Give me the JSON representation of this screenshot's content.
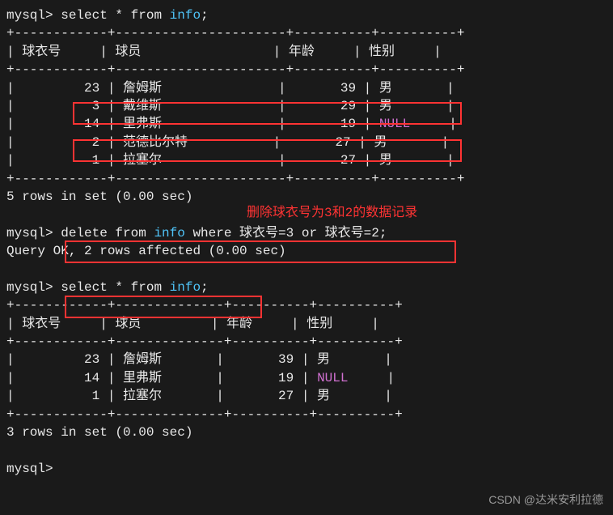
{
  "prompt": "mysql>",
  "queries": {
    "select1": "select * from ",
    "select1_table": "info",
    "select1_end": ";",
    "delete": "delete from ",
    "delete_table": "info",
    "delete_where": " where 球衣号=3 or 球衣号=2;",
    "select2": "select * from ",
    "select2_table": "info",
    "select2_end": ";"
  },
  "responses": {
    "rows1": "5 rows in set (0.00 sec)",
    "delete_ok": "Query OK, 2 rows affected (0.00 sec)",
    "rows2": "3 rows in set (0.00 sec)"
  },
  "table1": {
    "border_top": "+------------+----------------------+----------+----------+",
    "header": "| 球衣号     | 球员                 | 年龄     | 性别     |",
    "border_mid": "+------------+----------------------+----------+----------+",
    "rows": [
      "|         23 | 詹姆斯               |       39 | 男       |",
      "|          3 | 戴维斯               |       29 | 男       |",
      "|         14 | 里弗斯               |       19 | ",
      "|          2 | 范德比尔特           |       27 | 男       |",
      "|          1 | 拉塞尔               |       27 | 男       |"
    ],
    "null_text": "NULL",
    "null_suffix": "     |",
    "border_bot": "+------------+----------------------+----------+----------+"
  },
  "table2": {
    "border_top": "+------------+--------------+----------+----------+",
    "header": "| 球衣号     | 球员         | 年龄     | 性别     |",
    "border_mid": "+------------+--------------+----------+----------+",
    "rows": [
      "|         23 | 詹姆斯       |       39 | 男       |",
      "|         14 | 里弗斯       |       19 | ",
      "|          1 | 拉塞尔       |       27 | 男       |"
    ],
    "null_text": "NULL",
    "null_suffix": "     |",
    "border_bot": "+------------+--------------+----------+----------+"
  },
  "annotation": "删除球衣号为3和2的数据记录",
  "watermark": "CSDN @达米安利拉德"
}
